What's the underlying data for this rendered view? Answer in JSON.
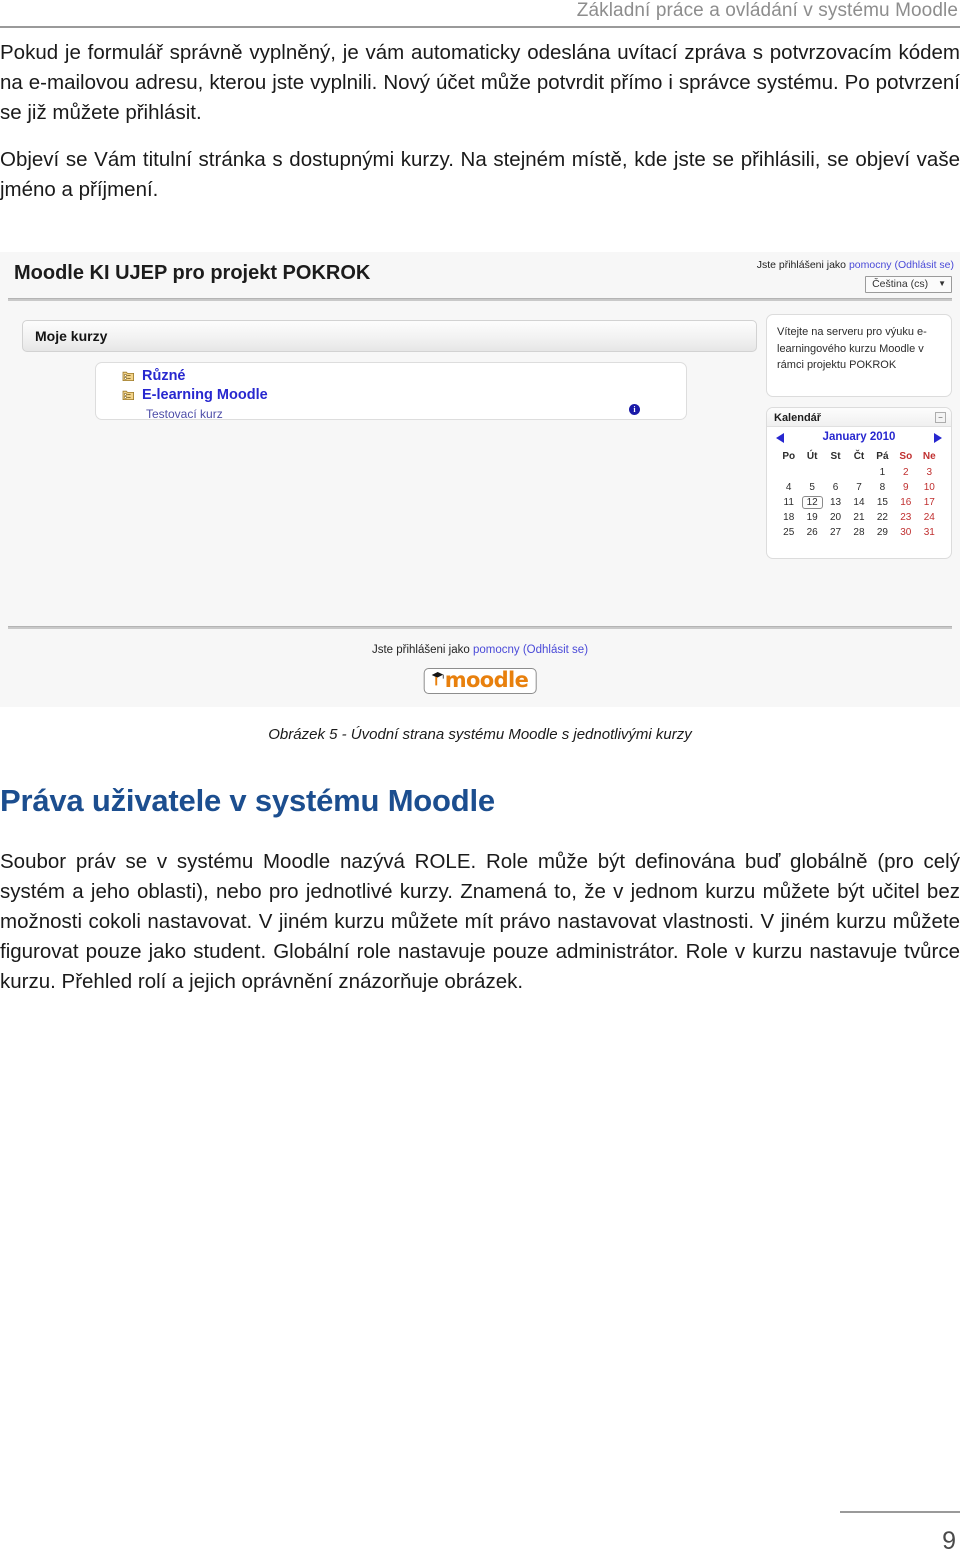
{
  "running_head": {
    "text": "Základní práce a ovládání v systému Moodle"
  },
  "body_top": {
    "paragraphs": [
      "Pokud je formulář správně vyplněný, je vám automaticky odeslána uvítací zpráva s potvrzovacím kódem na e-mailovou adresu, kterou jste vyplnili. Nový účet může potvrdit přímo i správce systému. Po potvrzení se již můžete přihlásit.",
      "Objeví se Vám titulní stránka s dostupnými kurzy. Na stejném místě, kde jste se přihlásili, se objeví vaše jméno a příjmení."
    ]
  },
  "screenshot": {
    "site_title": "Moodle KI UJEP pro projekt POKROK",
    "login_prefix": "Jste přihlášeni jako ",
    "login_user": "pomocny",
    "login_logout": "(Odhlásit se)",
    "language_selected": "Čeština (cs)",
    "panel_title": "Moje kurzy",
    "courses": [
      {
        "label": "Různé",
        "icon": "category-folder-icon"
      },
      {
        "label": "E-learning Moodle",
        "icon": "category-folder-icon"
      }
    ],
    "subcourse": "Testovací kurz",
    "info_icon_label": "i",
    "welcome_text": "Vítejte na serveru pro výuku e-learningového kurzu Moodle v rámci projektu POKROK",
    "calendar": {
      "title": "Kalendář",
      "minimize_glyph": "−",
      "month": "January 2010",
      "weekday_headers": [
        "Po",
        "Út",
        "St",
        "Čt",
        "Pá",
        "So",
        "Ne"
      ],
      "weekend_indices": [
        5,
        6
      ],
      "weeks": [
        [
          "",
          "",
          "",
          "",
          "1",
          "2",
          "3"
        ],
        [
          "4",
          "5",
          "6",
          "7",
          "8",
          "9",
          "10"
        ],
        [
          "11",
          "12",
          "13",
          "14",
          "15",
          "16",
          "17"
        ],
        [
          "18",
          "19",
          "20",
          "21",
          "22",
          "23",
          "24"
        ],
        [
          "25",
          "26",
          "27",
          "28",
          "29",
          "30",
          "31"
        ]
      ],
      "today": "12"
    },
    "footer_login_prefix": "Jste přihlášeni jako ",
    "footer_login_user": "pomocny",
    "footer_login_logout": "(Odhlásit se)",
    "logo_word": "moodle"
  },
  "figure_caption": "Obrázek 5 - Úvodní strana systému Moodle s jednotlivými kurzy",
  "section_heading": "Práva uživatele v systému Moodle",
  "body_bottom": {
    "paragraphs": [
      "Soubor práv se v systému Moodle nazývá ROLE. Role může být definována buď globálně (pro celý systém a jeho oblasti), nebo pro jednotlivé kurzy. Znamená to, že v jednom kurzu můžete být učitel bez možnosti cokoli nastavovat. V jiném kurzu můžete mít právo nastavovat vlastnosti. V jiném kurzu můžete figurovat pouze jako student. Globální role nastavuje pouze administrátor. Role v kurzu nastavuje tvůrce kurzu. Přehled rolí a jejich oprávnění znázorňuje obrázek."
    ]
  },
  "page_number": "9",
  "colors": {
    "heading_blue": "#1c4e8f",
    "link_blue": "#2727cf",
    "weekend_red": "#c03030",
    "logo_orange": "#e8800d",
    "rule_gray": "#9a9a9a"
  }
}
